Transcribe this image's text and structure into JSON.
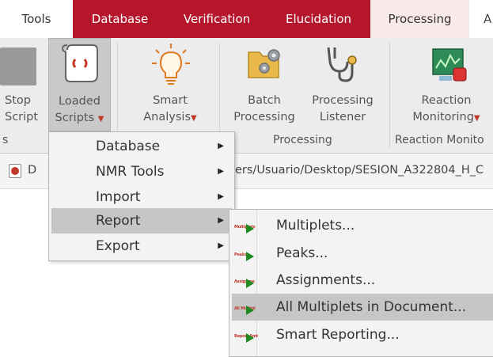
{
  "tabs": {
    "tools": "Tools",
    "database": "Database",
    "verification": "Verification",
    "elucidation": "Elucidation",
    "processing": "Processing",
    "overflow": "A"
  },
  "ribbon": {
    "stop_script": {
      "line1": "Stop",
      "line2": "Script"
    },
    "loaded_scripts": {
      "line1": "Loaded",
      "line2": "Scripts"
    },
    "smart_analysis": {
      "line1": "Smart",
      "line2": "Analysis"
    },
    "batch_processing": {
      "line1": "Batch",
      "line2": "Processing"
    },
    "processing_listener": {
      "line1": "Processing",
      "line2": "Listener"
    },
    "reaction_monitoring": {
      "line1": "Reaction",
      "line2": "Monitoring"
    },
    "group_left_fragment": "s",
    "group_processing": "Processing",
    "group_reaction": "Reaction Monito"
  },
  "docbar": {
    "doc_label_fragment": "D",
    "path_fragment": "ers/Usuario/Desktop/SESION_A322804_H_C"
  },
  "menu": {
    "items": [
      "Database",
      "NMR Tools",
      "Import",
      "Report",
      "Export"
    ]
  },
  "submenu": {
    "items": [
      "Multiplets...",
      "Peaks...",
      "Assignments...",
      "All Multiplets in Document...",
      "Smart Reporting..."
    ],
    "thumb_labels": [
      "Multiplets",
      "Peaks",
      "Assignme",
      "All Multipl",
      "Report Smt"
    ]
  },
  "colors": {
    "brand_red": "#b5162b",
    "play_green": "#1f8a1f",
    "highlight": "#c6c6c6"
  }
}
